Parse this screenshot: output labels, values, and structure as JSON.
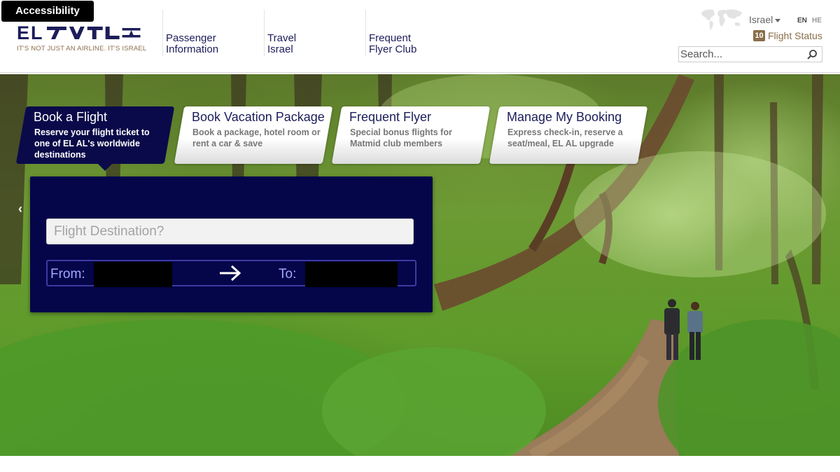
{
  "accessibility_label": "Accessibility",
  "logo": {
    "text": "EL",
    "tagline": "IT'S NOT JUST AN AIRLINE. IT'S ISRAEL"
  },
  "nav": [
    {
      "line1": "Passenger",
      "line2": "Information"
    },
    {
      "line1": "Travel",
      "line2": "Israel"
    },
    {
      "line1": "Frequent",
      "line2": "Flyer Club"
    }
  ],
  "utility": {
    "country": "Israel",
    "lang_en": "EN",
    "lang_he": "HE",
    "flight_status_badge": "10",
    "flight_status_label": "Flight Status",
    "search_placeholder": "Search..."
  },
  "tabs": [
    {
      "title": "Book a Flight",
      "desc": "Reserve your flight ticket to one of EL AL's worldwide destinations",
      "active": true
    },
    {
      "title": "Book Vacation Package",
      "desc_line1": "Book a package, hotel room or",
      "desc_line2": "rent a car & save",
      "active": false
    },
    {
      "title": "Frequent Flyer",
      "desc_line1": "Special bonus flights for",
      "desc_line2": "Matmid club members",
      "active": false
    },
    {
      "title": "Manage My Booking",
      "desc_line1": "Express check-in, reserve a",
      "desc_line2": "seat/meal, EL AL upgrade",
      "active": false
    }
  ],
  "booking": {
    "destination_placeholder": "Flight Destination?",
    "from_label": "From:",
    "to_label": "To:"
  },
  "carousel_prev": "‹",
  "colors": {
    "brand_navy": "#0a0a4a",
    "brand_brown": "#8a6e4a"
  }
}
